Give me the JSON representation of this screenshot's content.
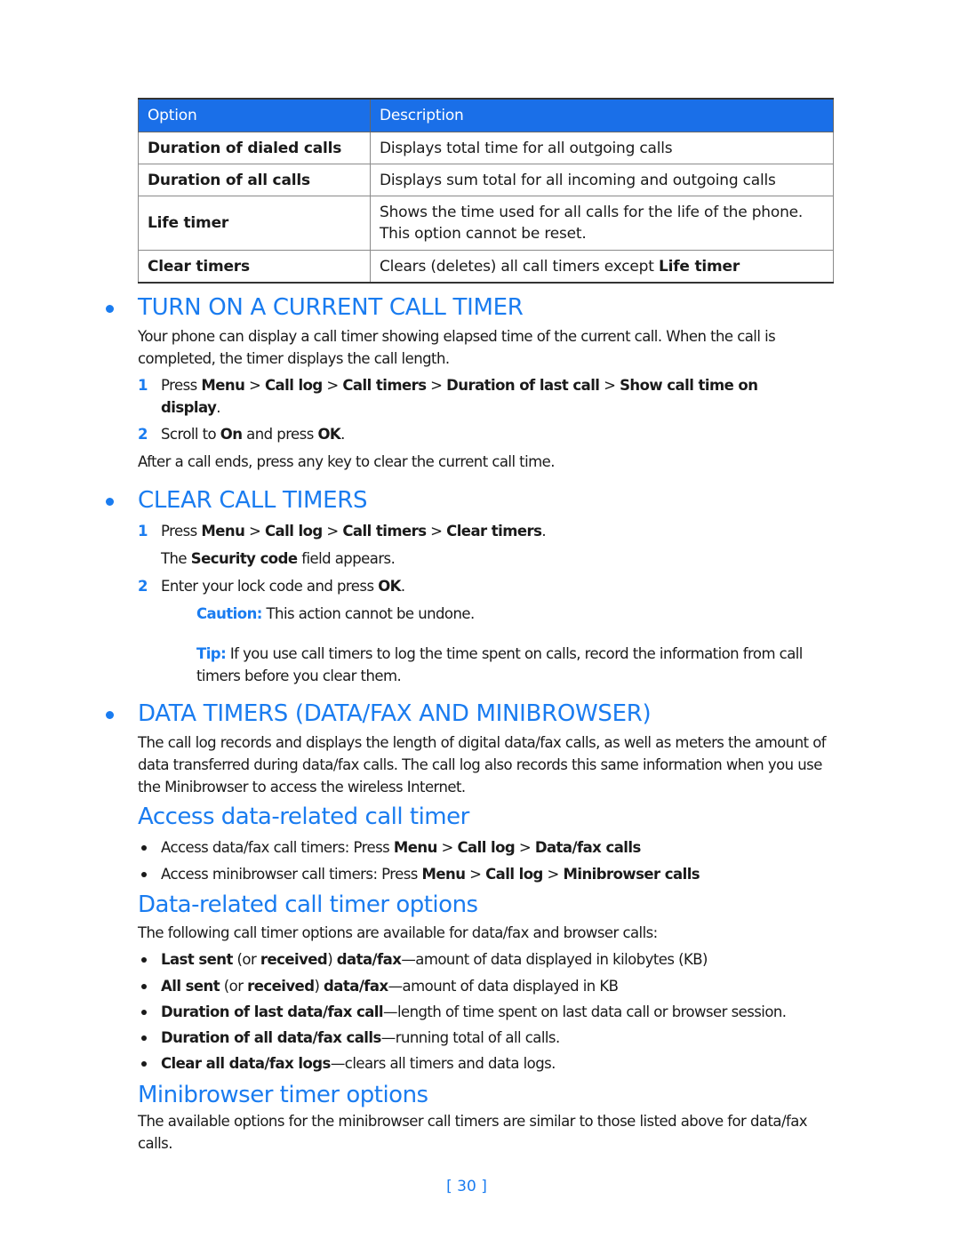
{
  "table": {
    "headers": [
      "Option",
      "Description"
    ],
    "rows": [
      {
        "option": "Duration of dialed calls",
        "description": "Displays total time for all outgoing calls"
      },
      {
        "option": "Duration of all calls",
        "description": "Displays sum total for all incoming and outgoing calls"
      },
      {
        "option": "Life timer",
        "description_line1": "Shows the time used for all calls for the life of the phone.",
        "description_line2": "This option cannot be reset."
      },
      {
        "option": "Clear timers",
        "description_prefix": "Clears (deletes) all call timers except ",
        "description_bold": "Life timer"
      }
    ]
  },
  "section_current_timer": {
    "heading": "TURN ON A CURRENT CALL TIMER",
    "intro": "Your phone can display a call timer showing elapsed time of the current call. When the call is completed, the timer displays the call length.",
    "steps": [
      {
        "num": "1",
        "parts": [
          "Press ",
          "Menu",
          " > ",
          "Call log",
          " > ",
          "Call timers",
          " > ",
          "Duration of last call",
          " > ",
          "Show call time on display",
          "."
        ]
      },
      {
        "num": "2",
        "parts": [
          "Scroll to ",
          "On",
          " and press ",
          "OK",
          "."
        ]
      }
    ],
    "after": "After a call ends, press any key to clear the current call time."
  },
  "section_clear_timers": {
    "heading": "CLEAR CALL TIMERS",
    "steps": [
      {
        "num": "1",
        "parts": [
          "Press ",
          "Menu",
          " > ",
          "Call log",
          " > ",
          "Call timers",
          " > ",
          "Clear timers",
          "."
        ],
        "sub_parts": [
          "The ",
          "Security code",
          " field appears."
        ]
      },
      {
        "num": "2",
        "parts": [
          "Enter your lock code and press ",
          "OK",
          "."
        ]
      }
    ],
    "caution_label": "Caution:",
    "caution_text": " This action cannot be undone.",
    "tip_label": "Tip:",
    "tip_text": " If you use call timers to log the time spent on calls, record the information from call timers before you clear them."
  },
  "section_data_timers": {
    "heading": "DATA TIMERS (DATA/FAX AND MINIBROWSER)",
    "intro": "The call log records and displays the length of digital data/fax calls, as well as meters the amount of data transferred during data/fax calls. The call log also records this same information when you use the Minibrowser to access the wireless Internet."
  },
  "access": {
    "heading": "Access data-related call timer",
    "items": [
      {
        "parts": [
          "Access data/fax call timers: Press ",
          "Menu",
          " > ",
          "Call log",
          " > ",
          "Data/fax calls"
        ]
      },
      {
        "parts": [
          "Access minibrowser call timers: Press ",
          "Menu",
          " > ",
          "Call log",
          " > ",
          "Minibrowser calls"
        ]
      }
    ]
  },
  "options": {
    "heading": "Data-related call timer options",
    "intro": "The following call timer options are available for data/fax and browser calls:",
    "items": [
      {
        "parts": [
          "Last sent",
          " (or ",
          "received",
          ") ",
          "data/fax",
          "—amount of data displayed in kilobytes (KB)"
        ]
      },
      {
        "parts": [
          "All sent",
          " (or ",
          "received",
          ") ",
          "data/fax",
          "—amount of data displayed in KB"
        ]
      },
      {
        "parts": [
          "Duration of last data/fax call",
          "—length of time spent on last data call or browser session."
        ]
      },
      {
        "parts": [
          "Duration of all data/fax calls",
          "—running total of all calls."
        ]
      },
      {
        "parts": [
          "Clear all data/fax logs",
          "—clears all timers and data logs."
        ]
      }
    ]
  },
  "minibrowser": {
    "heading": "Minibrowser timer options",
    "text": "The available options for the minibrowser call timers are similar to those listed above for data/fax calls."
  },
  "page_number": "[ 30 ]"
}
